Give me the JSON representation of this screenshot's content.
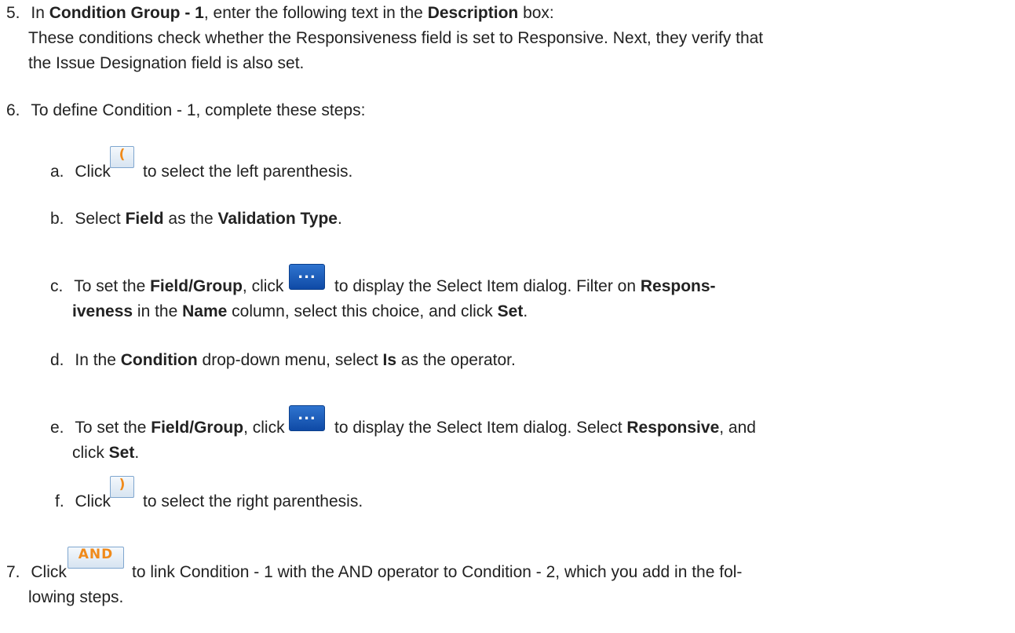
{
  "step5": {
    "num": "5.",
    "t1": "In ",
    "b1": "Condition Group - 1",
    "t2": ", enter the following text in the ",
    "b2": "Description",
    "t3": " box:",
    "line2": "These conditions check whether the Responsiveness field is set to Responsive. Next, they verify that",
    "line3": "the Issue Designation field is also set."
  },
  "step6": {
    "num": "6.",
    "text": "To define Condition - 1, complete these steps:",
    "a": {
      "letter": "a.",
      "t1": "Click",
      "icon_text": "(",
      "t2": "to select the left parenthesis."
    },
    "b": {
      "letter": "b.",
      "t1": "Select ",
      "b1": "Field",
      "t2": " as the ",
      "b2": "Validation Type",
      "t3": "."
    },
    "c": {
      "letter": "c.",
      "t1": "To set the ",
      "b1": "Field/Group",
      "t2": ", click",
      "icon_text": "...",
      "t3": "to display the Select Item dialog. Filter on ",
      "b2": "Respons-",
      "l2_b1": "iveness",
      "l2_t1": " in the ",
      "l2_b2": "Name",
      "l2_t2": " column, select this choice, and click ",
      "l2_b3": "Set",
      "l2_t3": "."
    },
    "d": {
      "letter": "d.",
      "t1": "In the ",
      "b1": "Condition",
      "t2": " drop-down menu, select ",
      "b2": "Is",
      "t3": " as the operator."
    },
    "e": {
      "letter": "e.",
      "t1": "To set the ",
      "b1": "Field/Group",
      "t2": ", click",
      "icon_text": "...",
      "t3": "to display the Select Item dialog. Select ",
      "b2": "Responsive",
      "t4": ", and",
      "l2_t1": "click ",
      "l2_b1": "Set",
      "l2_t2": "."
    },
    "f": {
      "letter": "f.",
      "t1": "Click",
      "icon_text": ")",
      "t2": "to select the right parenthesis."
    }
  },
  "step7": {
    "num": "7.",
    "t1": "Click",
    "icon_text": "AND",
    "t2": "to link Condition - 1 with the AND operator to Condition - 2, which you add in the fol-",
    "line2": "lowing steps."
  }
}
